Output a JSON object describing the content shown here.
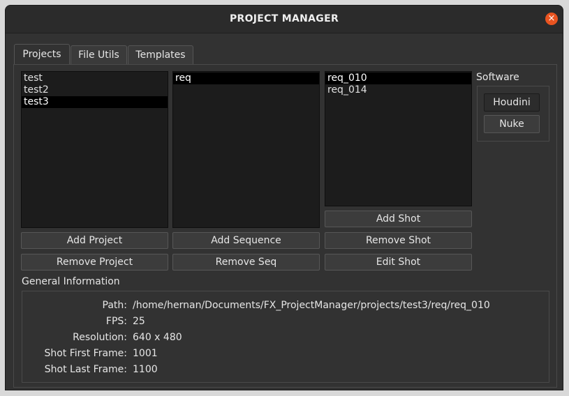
{
  "window": {
    "title": "PROJECT MANAGER",
    "close_symbol": "×"
  },
  "tabs": [
    {
      "label": "Projects",
      "active": true
    },
    {
      "label": "File Utils",
      "active": false
    },
    {
      "label": "Templates",
      "active": false
    }
  ],
  "projects": {
    "items": [
      "test",
      "test2",
      "test3"
    ],
    "selected": "test3",
    "add_label": "Add Project",
    "remove_label": "Remove Project"
  },
  "sequences": {
    "items": [
      "req"
    ],
    "selected": "req",
    "add_label": "Add Sequence",
    "remove_label": "Remove Seq"
  },
  "shots": {
    "items": [
      "req_010",
      "req_014"
    ],
    "selected": "req_010",
    "add_label": "Add Shot",
    "remove_label": "Remove Shot",
    "edit_label": "Edit Shot"
  },
  "software": {
    "title": "Software",
    "houdini_label": "Houdini",
    "nuke_label": "Nuke"
  },
  "general_info": {
    "title": "General Information",
    "path_key": "Path:",
    "path_value": "/home/hernan/Documents/FX_ProjectManager/projects/test3/req/req_010",
    "fps_key": "FPS:",
    "fps_value": "25",
    "resolution_key": "Resolution:",
    "resolution_value": "640 x 480",
    "first_frame_key": "Shot First Frame:",
    "first_frame_value": "1001",
    "last_frame_key": "Shot Last Frame:",
    "last_frame_value": "1100"
  }
}
